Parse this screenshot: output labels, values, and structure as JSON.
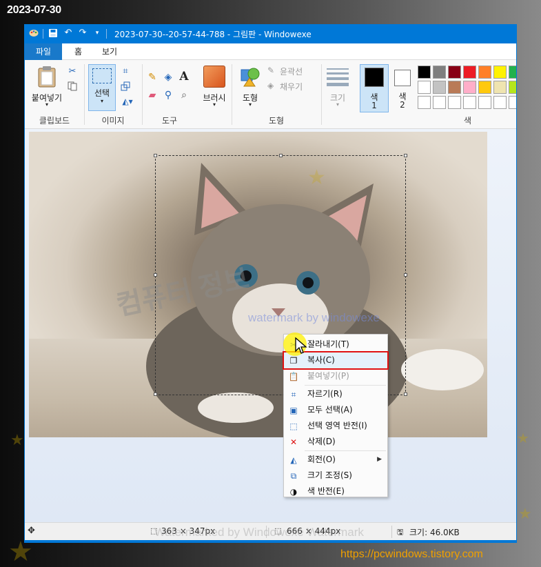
{
  "overlay": {
    "date": "2023-07-30",
    "url": "https://pcwindows.tistory.com",
    "watermark_big": "컴퓨터 정보",
    "watermark_small": "watermark by windowexe",
    "watermark_bottom": "Watermarked by Windowexe Watermark"
  },
  "window": {
    "title": "2023-07-30--20-57-44-788 - 그림판   - Windowexe"
  },
  "tabs": [
    "파일",
    "홈",
    "보기"
  ],
  "ribbon": {
    "paste_label": "붙여넣기",
    "select_label": "선택",
    "brush_label": "브러시",
    "shapes_label": "도형",
    "outline_label": "윤곽선",
    "fill_label": "채우기",
    "size_label": "크기",
    "color1_label": "색\n1",
    "color1_a": "색",
    "color1_b": "1",
    "color2_a": "색",
    "color2_b": "2",
    "groups": {
      "clipboard": "클립보드",
      "image": "이미지",
      "tools": "도구",
      "shapes": "도형",
      "colors": "색"
    },
    "palette_row1": [
      "#000000",
      "#7f7f7f",
      "#880015",
      "#ed1c24",
      "#ff7f27",
      "#fff200",
      "#22b14c"
    ],
    "palette_row2": [
      "#ffffff",
      "#c3c3c3",
      "#b97a57",
      "#ffaec9",
      "#ffc90e",
      "#efe4b0",
      "#b5e61d"
    ],
    "color1": "#000000",
    "color2": "#ffffff"
  },
  "context_menu": [
    {
      "label": "잘라내기(T)",
      "icon": "scissors-icon",
      "state": "normal"
    },
    {
      "label": "복사(C)",
      "icon": "copy-icon",
      "state": "highlighted"
    },
    {
      "label": "붙여넣기(P)",
      "icon": "paste-icon",
      "state": "disabled"
    },
    {
      "label": "자르기(R)",
      "icon": "crop-icon",
      "state": "normal"
    },
    {
      "label": "모두 선택(A)",
      "icon": "select-all-icon",
      "state": "normal"
    },
    {
      "label": "선택 영역 반전(I)",
      "icon": "invert-selection-icon",
      "state": "normal"
    },
    {
      "label": "삭제(D)",
      "icon": "delete-icon",
      "state": "normal"
    },
    {
      "label": "회전(O)",
      "icon": "rotate-icon",
      "state": "normal",
      "submenu": true
    },
    {
      "label": "크기 조정(S)",
      "icon": "resize-icon",
      "state": "normal"
    },
    {
      "label": "색 반전(E)",
      "icon": "invert-color-icon",
      "state": "normal"
    }
  ],
  "status": {
    "selection_size": "363 × 347px",
    "canvas_size": "666 × 444px",
    "file_size": "크기: 46.0KB"
  }
}
